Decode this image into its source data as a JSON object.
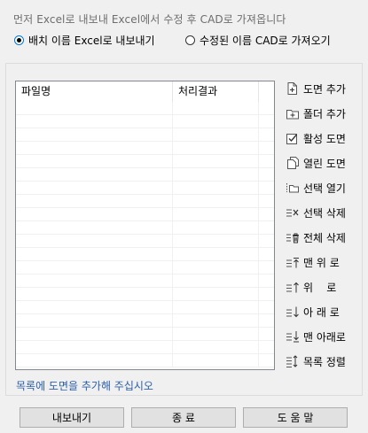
{
  "description": "먼저 Excel로 내보내 Excel에서 수정 후 CAD로 가져옵니다",
  "options": [
    {
      "label": "배치 이름 Excel로 내보내기",
      "selected": true
    },
    {
      "label": "수정된 이름 CAD로 가져오기",
      "selected": false
    }
  ],
  "list": {
    "columns": [
      "파일명",
      "처리결과"
    ],
    "rows": []
  },
  "side_buttons": [
    {
      "label": "도면 추가",
      "icon": "add-drawing-icon"
    },
    {
      "label": "폴더 추가",
      "icon": "add-folder-icon"
    },
    {
      "label": "활성 도면",
      "icon": "active-drawing-icon"
    },
    {
      "label": "열린 도면",
      "icon": "open-drawings-icon"
    },
    {
      "label": "선택 열기",
      "icon": "open-selected-icon"
    },
    {
      "label": "선택 삭제",
      "icon": "delete-selected-icon"
    },
    {
      "label": "전체 삭제",
      "icon": "delete-all-icon"
    },
    {
      "label": "맨 위 로",
      "icon": "move-top-icon"
    },
    {
      "label": "위    로",
      "icon": "move-up-icon"
    },
    {
      "label": "아 래 로",
      "icon": "move-down-icon"
    },
    {
      "label": "맨 아래로",
      "icon": "move-bottom-icon"
    },
    {
      "label": "목록 정렬",
      "icon": "sort-list-icon"
    }
  ],
  "hint": "목록에 도면을 추가해 주십시오",
  "buttons": {
    "export": "내보내기",
    "close": "종 료",
    "help": "도 움 말"
  }
}
